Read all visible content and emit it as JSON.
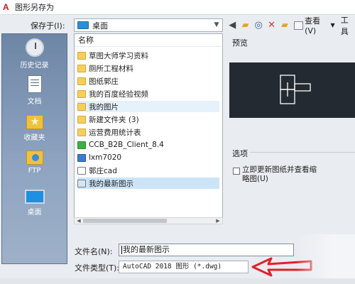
{
  "window": {
    "title": "图形另存为",
    "app_icon": "A"
  },
  "toolbar": {
    "save_in_label": "保存于(I):",
    "save_in_value": "桌面",
    "view_label": "查看(V)",
    "tools_label": "工具"
  },
  "places": [
    {
      "label": "历史记录",
      "icon": "history-icon"
    },
    {
      "label": "文档",
      "icon": "document-icon"
    },
    {
      "label": "收藏夹",
      "icon": "favorites-icon"
    },
    {
      "label": "FTP",
      "icon": "ftp-icon"
    },
    {
      "label": "桌面",
      "icon": "desktop-icon"
    }
  ],
  "filelist": {
    "column_header": "名称",
    "items": [
      {
        "name": "草图大师学习资料",
        "type": "folder"
      },
      {
        "name": "厕所工程材料",
        "type": "folder"
      },
      {
        "name": "图纸郭庄",
        "type": "folder"
      },
      {
        "name": "我的百度经验视频",
        "type": "folder"
      },
      {
        "name": "我的图片",
        "type": "folder"
      },
      {
        "name": "新建文件夹 (3)",
        "type": "folder"
      },
      {
        "name": "运营费用统计表",
        "type": "folder"
      },
      {
        "name": "CCB_B2B_Client_8.4",
        "type": "app-green"
      },
      {
        "name": "lxm7020",
        "type": "app-blue"
      },
      {
        "name": "郭庄cad",
        "type": "cad"
      },
      {
        "name": "我的最新图示",
        "type": "cad-selected"
      }
    ]
  },
  "preview": {
    "label": "预览"
  },
  "options": {
    "label": "选项",
    "update_thumbnail": "立即更新图纸并查看缩略图(U)"
  },
  "bottom": {
    "filename_label": "文件名(N):",
    "filename_value": "我的最新图示",
    "filetype_label": "文件类型(T):",
    "filetype_value": "AutoCAD 2018 图形 (*.dwg)"
  },
  "colors": {
    "annotation": "#e0202a",
    "selection": "#cce4f7",
    "places_bar": "#7f97b5"
  }
}
